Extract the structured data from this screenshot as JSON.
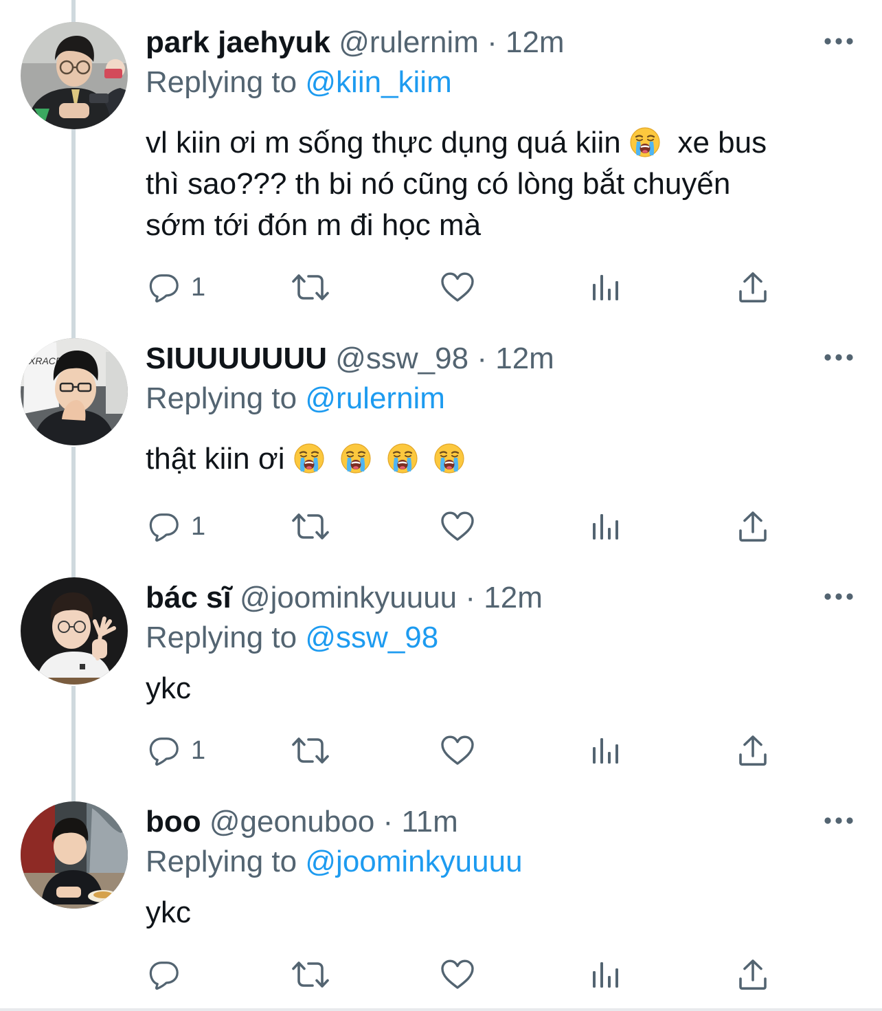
{
  "tweets": [
    {
      "name": "park jaehyuk",
      "handle": "@rulernim",
      "time": "12m",
      "replying_label": "Replying to",
      "replying_to": "@kiin_kiim",
      "lines": [
        "vl kiin ơi m sống thực dụng quá kiin",
        "xe bus",
        "thì sao??? th bi nó cũng có lòng bắt chuyến",
        "sớm tới đón m đi học mà"
      ],
      "reply_count": "1"
    },
    {
      "name": "SIUUUUUUU",
      "handle": "@ssw_98",
      "time": "12m",
      "replying_label": "Replying to",
      "replying_to": "@rulernim",
      "text": "thật kiin ơi",
      "reply_count": "1"
    },
    {
      "name": "bác sĩ",
      "handle": "@joominkyuuuu",
      "time": "12m",
      "replying_label": "Replying to",
      "replying_to": "@ssw_98",
      "text": "ykc",
      "reply_count": "1"
    },
    {
      "name": "boo",
      "handle": "@geonuboo",
      "time": "11m",
      "replying_label": "Replying to",
      "replying_to": "@joominkyuuuu",
      "text": "ykc",
      "reply_count": ""
    }
  ],
  "separator": "·",
  "icons": {
    "more": "more-horizontal-icon",
    "reply": "reply-bubble-icon",
    "retweet": "retweet-icon",
    "like": "heart-icon",
    "views": "bar-chart-icon",
    "share": "share-upload-icon",
    "emoji": "loudly-crying-face-emoji"
  },
  "colors": {
    "text": "#0f1419",
    "secondary": "#536471",
    "link": "#1d9bf0",
    "thread_line": "#cfd9de"
  }
}
